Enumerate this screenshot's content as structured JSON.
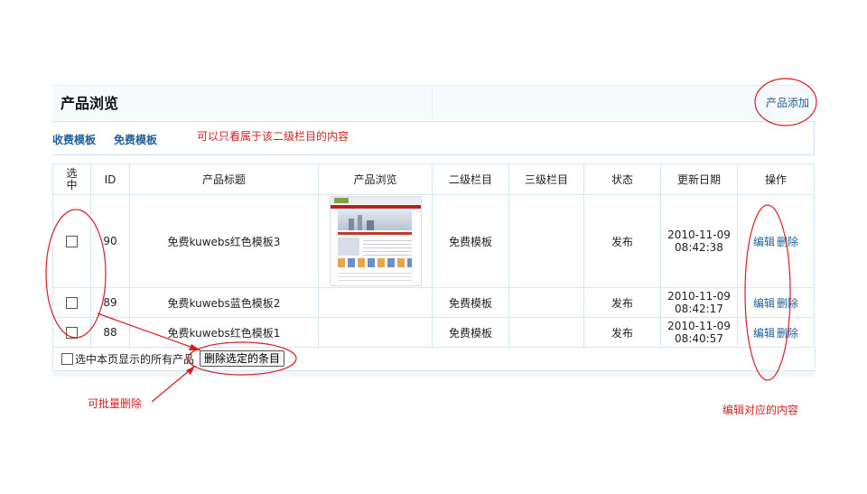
{
  "header": {
    "title": "产品浏览",
    "add_link": "产品添加"
  },
  "categories": [
    {
      "label": "收费模板"
    },
    {
      "label": "免费模板"
    }
  ],
  "table": {
    "headers": {
      "select": "选中",
      "id": "ID",
      "title": "产品标题",
      "preview": "产品浏览",
      "level2": "二级栏目",
      "level3": "三级栏目",
      "status": "状态",
      "updated": "更新日期",
      "ops": "操作"
    },
    "rows": [
      {
        "id": "90",
        "title": "免费kuwebs红色模板3",
        "level2": "免费模板",
        "level3": "",
        "status": "发布",
        "date": "2010-11-09",
        "time": "08:42:38",
        "edit": "编辑",
        "delete": "删除",
        "has_preview": true
      },
      {
        "id": "89",
        "title": "免费kuwebs蓝色模板2",
        "level2": "免费模板",
        "level3": "",
        "status": "发布",
        "date": "2010-11-09",
        "time": "08:42:17",
        "edit": "编辑",
        "delete": "删除",
        "has_preview": false
      },
      {
        "id": "88",
        "title": "免费kuwebs红色模板1",
        "level2": "免费模板",
        "level3": "",
        "status": "发布",
        "date": "2010-11-09",
        "time": "08:40:57",
        "edit": "编辑",
        "delete": "删除",
        "has_preview": false
      }
    ]
  },
  "bulk": {
    "select_all_label": "选中本页显示的所有产品",
    "delete_button": "删除选定的条目"
  },
  "annotations": {
    "category_note": "可以只看属于该二级栏目的内容",
    "batch_note": "可批量删除",
    "edit_note": "编辑对应的内容",
    "color": "#d42020"
  }
}
